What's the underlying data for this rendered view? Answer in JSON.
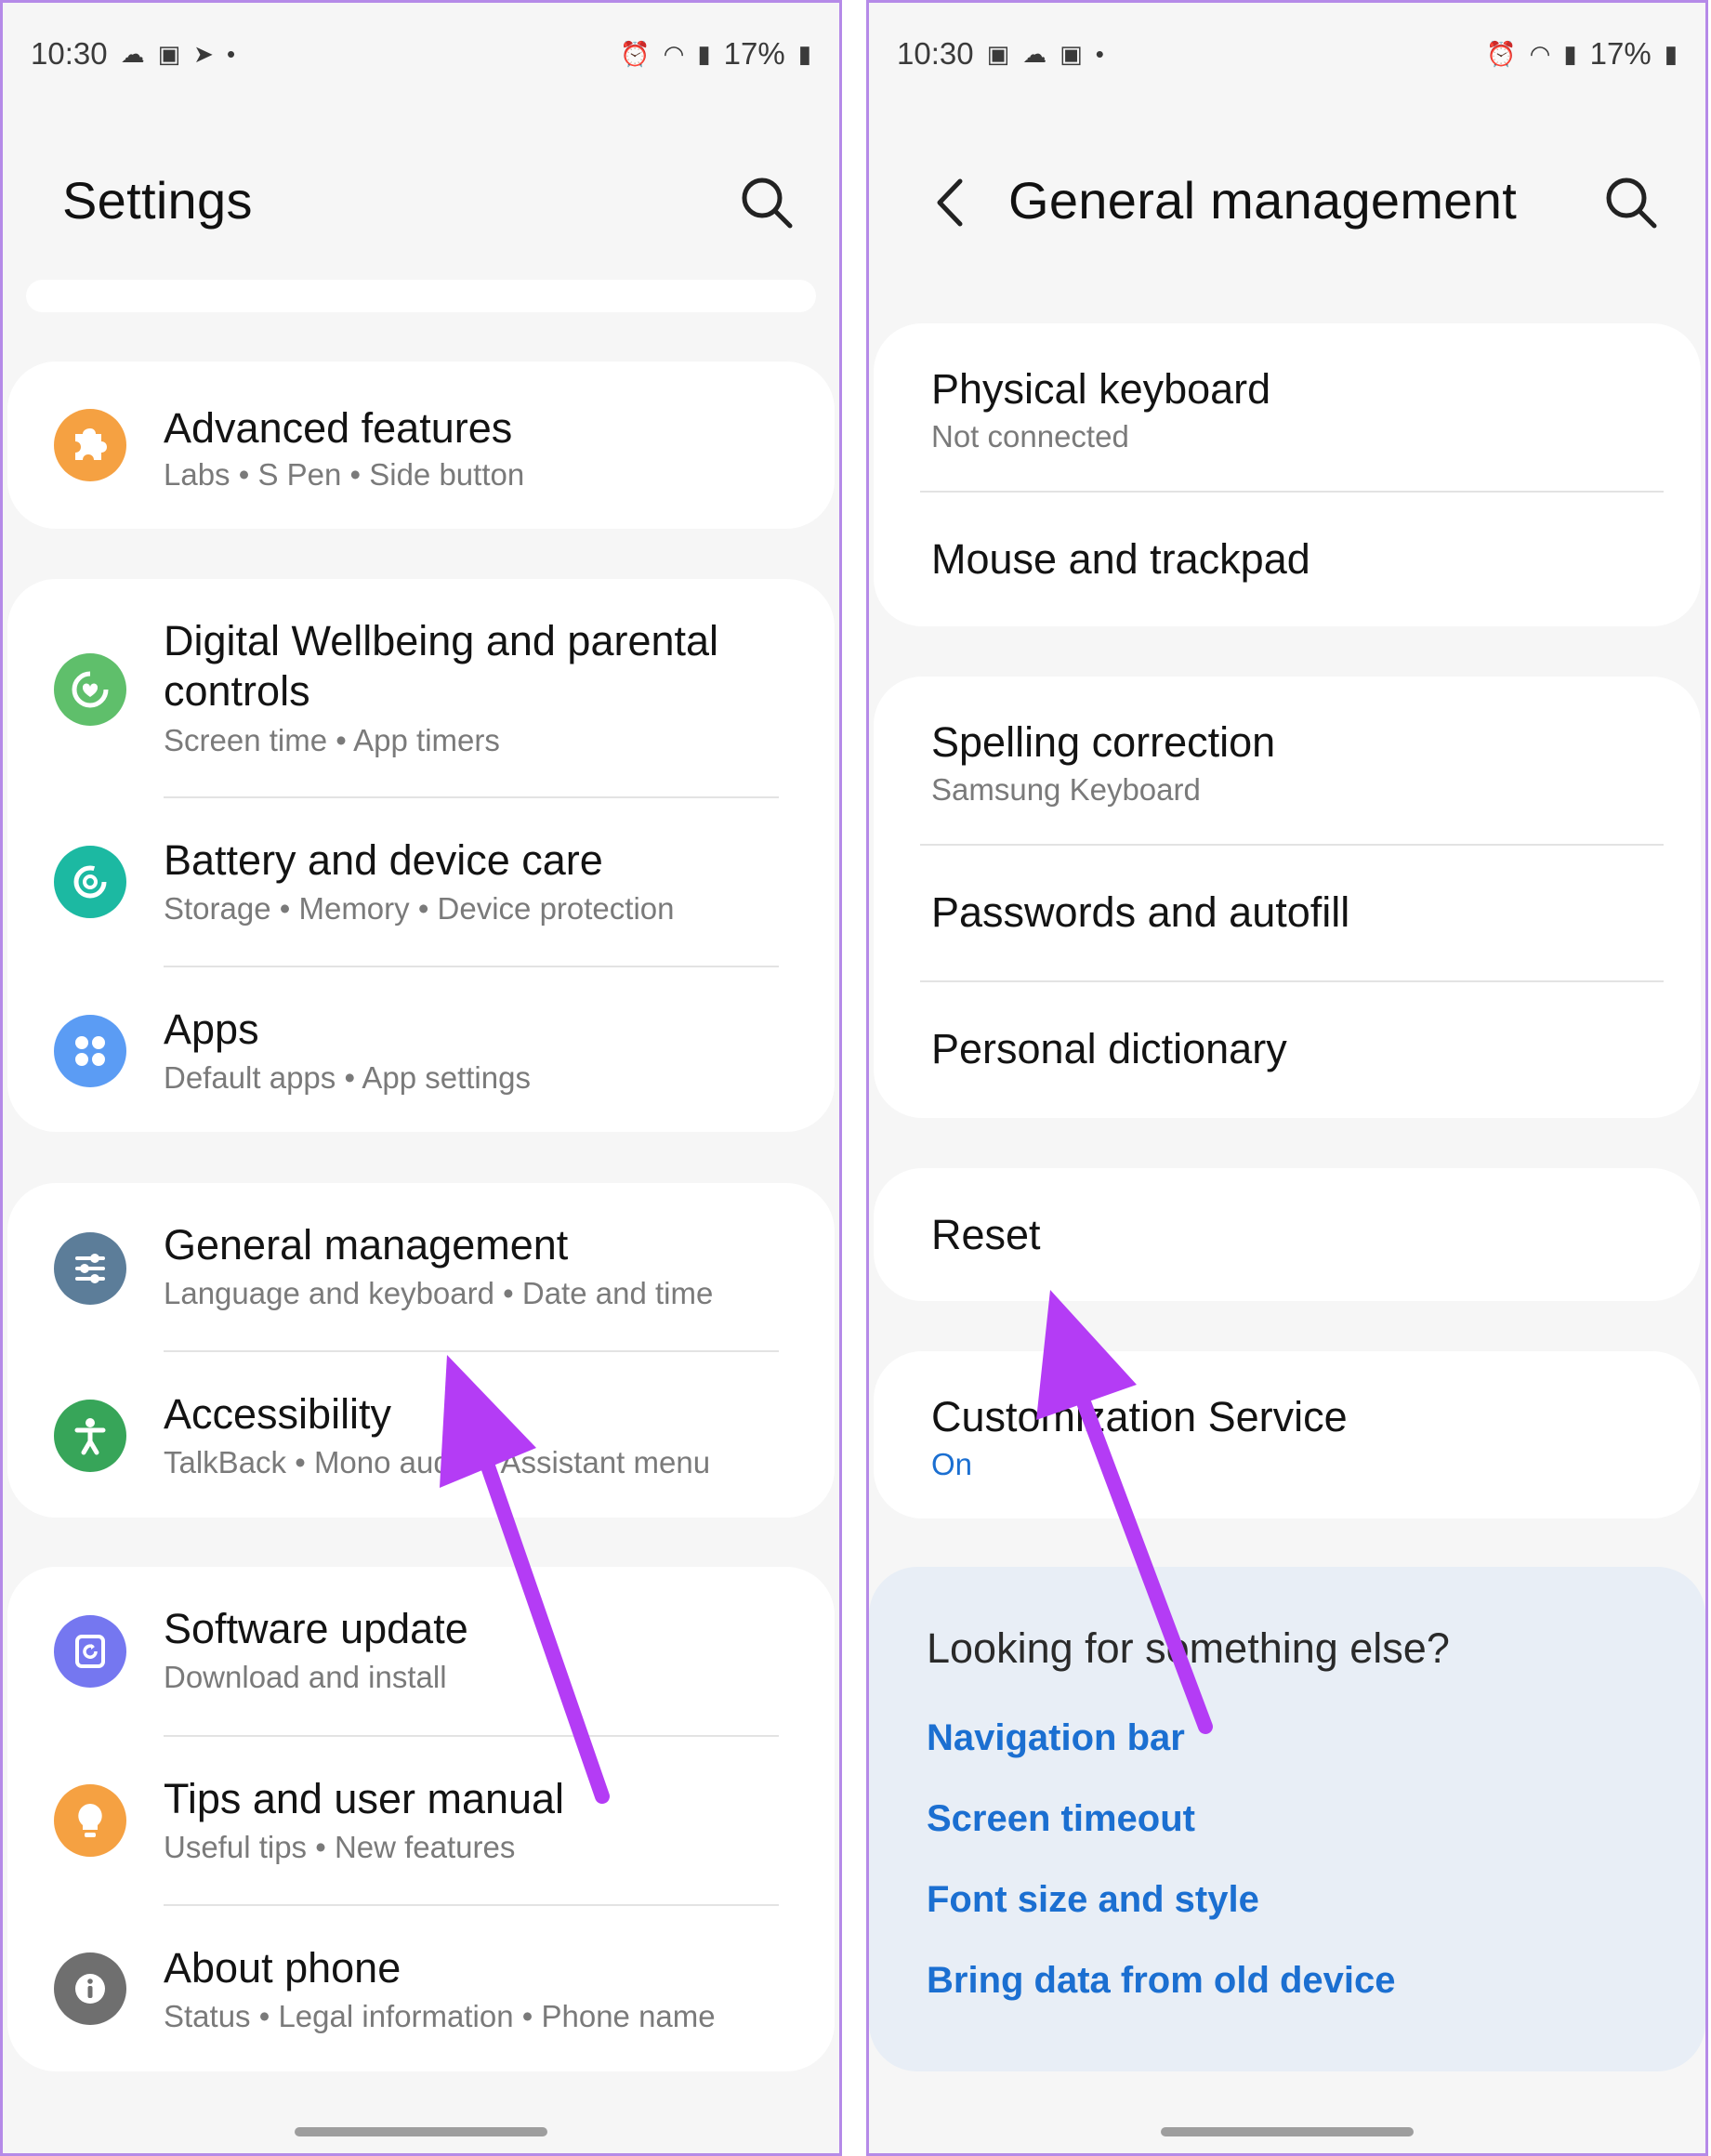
{
  "left": {
    "status": {
      "time": "10:30",
      "battery": "17%"
    },
    "title": "Settings",
    "cards": [
      {
        "items": [
          {
            "title": "Advanced features",
            "subtitle": "Labs  •  S Pen  •  Side button",
            "icon": "puzzle-icon",
            "color": "#f5a142"
          }
        ]
      },
      {
        "items": [
          {
            "title": "Digital Wellbeing and parental controls",
            "subtitle": "Screen time  •  App timers",
            "icon": "wellbeing-icon",
            "color": "#5fbf6b"
          },
          {
            "title": "Battery and device care",
            "subtitle": "Storage  •  Memory  •  Device protection",
            "icon": "device-care-icon",
            "color": "#1cb9a2"
          },
          {
            "title": "Apps",
            "subtitle": "Default apps  •  App settings",
            "icon": "apps-icon",
            "color": "#5b9cf4"
          }
        ]
      },
      {
        "items": [
          {
            "title": "General management",
            "subtitle": "Language and keyboard  •  Date and time",
            "icon": "sliders-icon",
            "color": "#5c7d99"
          },
          {
            "title": "Accessibility",
            "subtitle": "TalkBack  •  Mono audio  •  Assistant menu",
            "icon": "accessibility-icon",
            "color": "#37a559"
          }
        ]
      },
      {
        "items": [
          {
            "title": "Software update",
            "subtitle": "Download and install",
            "icon": "software-update-icon",
            "color": "#7577f0"
          },
          {
            "title": "Tips and user manual",
            "subtitle": "Useful tips  •  New features",
            "icon": "bulb-icon",
            "color": "#f5a142"
          },
          {
            "title": "About phone",
            "subtitle": "Status  •  Legal information  •  Phone name",
            "icon": "info-icon",
            "color": "#6f6f6f"
          }
        ]
      }
    ]
  },
  "right": {
    "status": {
      "time": "10:30",
      "battery": "17%"
    },
    "title": "General management",
    "groups": [
      {
        "items": [
          {
            "title": "Physical keyboard",
            "subtitle": "Not connected"
          },
          {
            "title": "Mouse and trackpad"
          }
        ]
      },
      {
        "items": [
          {
            "title": "Spelling correction",
            "subtitle": "Samsung Keyboard"
          },
          {
            "title": "Passwords and autofill"
          },
          {
            "title": "Personal dictionary"
          }
        ]
      },
      {
        "items": [
          {
            "title": "Reset"
          }
        ]
      },
      {
        "items": [
          {
            "title": "Customization Service",
            "subtitle": "On"
          }
        ]
      }
    ],
    "suggest": {
      "title": "Looking for something else?",
      "links": [
        "Navigation bar",
        "Screen timeout",
        "Font size and style",
        "Bring data from old device"
      ]
    }
  },
  "annotation_color": "#b43cf5"
}
